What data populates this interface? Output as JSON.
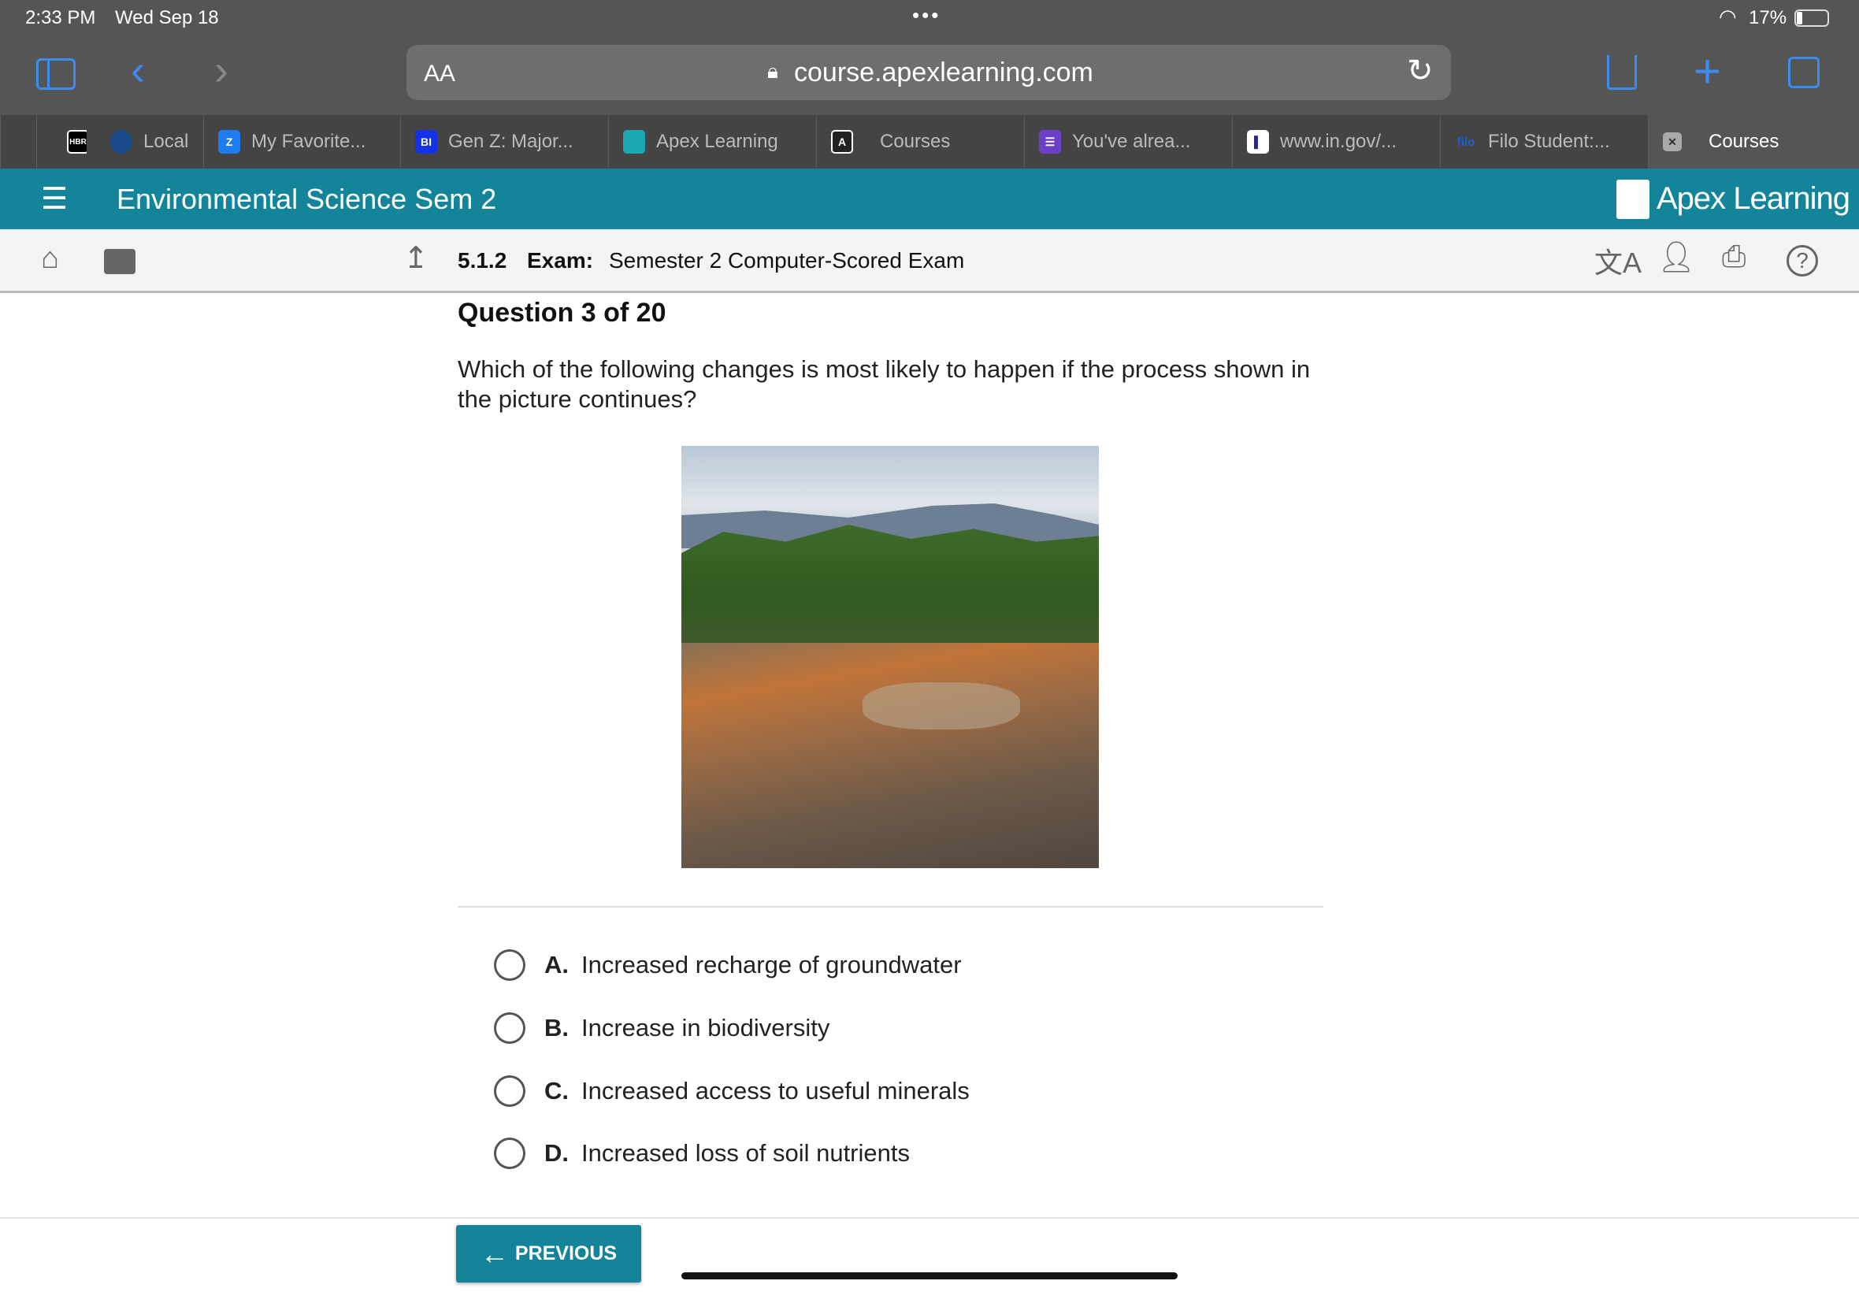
{
  "status": {
    "time": "2:33 PM",
    "date": "Wed Sep 18",
    "battery": "17%",
    "battery_level": 0.17
  },
  "browser": {
    "text_size_label": "AA",
    "url": "course.apexlearning.com"
  },
  "tabs": [
    {
      "label": "",
      "favicon": "HBR",
      "color": "#000"
    },
    {
      "label": "Local",
      "favicon": "",
      "color": "#1a4a8a"
    },
    {
      "label": "My Favorite...",
      "favicon": "Z",
      "color": "#1c7cf0"
    },
    {
      "label": "Gen Z: Major...",
      "favicon": "BI",
      "color": "#1433e8"
    },
    {
      "label": "Apex Learning",
      "favicon": "",
      "color": "#1aa8b0"
    },
    {
      "label": "Courses",
      "favicon": "A",
      "color": "#333"
    },
    {
      "label": "You've alrea...",
      "favicon": "☰",
      "color": "#6b3fc7"
    },
    {
      "label": "www.in.gov/...",
      "favicon": "",
      "color": "#fff"
    },
    {
      "label": "Filo Student:...",
      "favicon": "filo",
      "color": "#444"
    },
    {
      "label": "Courses",
      "favicon": "x",
      "color": "#999",
      "active": true
    }
  ],
  "header": {
    "menu_icon": "list-icon",
    "course_title": "Environmental Science Sem 2",
    "logo": "Apex Learning"
  },
  "subheader": {
    "number": "5.1.2",
    "type": "Exam:",
    "title": "Semester 2 Computer-Scored Exam"
  },
  "question": {
    "title": "Question 3 of 20",
    "text": "Which of the following changes is most likely to happen if the process shown in the picture continues?"
  },
  "options": [
    {
      "letter": "A.",
      "text": "Increased recharge of groundwater"
    },
    {
      "letter": "B.",
      "text": "Increase in biodiversity"
    },
    {
      "letter": "C.",
      "text": "Increased access to useful minerals"
    },
    {
      "letter": "D.",
      "text": "Increased loss of soil nutrients"
    }
  ],
  "footer": {
    "previous_label": "PREVIOUS"
  },
  "colors": {
    "brand": "#13849a",
    "browser_chrome": "#555555",
    "accent": "#3c8cf0"
  }
}
